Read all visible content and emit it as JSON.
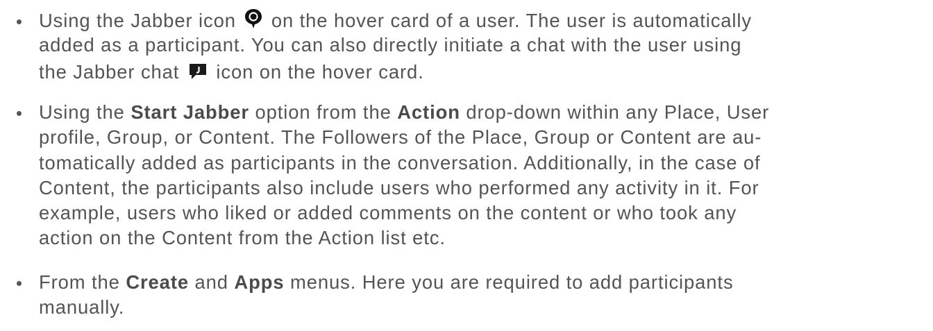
{
  "bullets": [
    {
      "l1_pre": "Using the Jabber icon",
      "l1_post": "on the hover card of a user. The user is automatically",
      "l2": "added as a participant. You can also directly initiate a chat with the user using",
      "l3_pre": "the Jabber chat",
      "l3_post": "icon on the hover card.",
      "icons": [
        "jabber-call-icon",
        "jabber-chat-icon"
      ]
    },
    {
      "l1_a": "Using the",
      "l1_b1": "Start Jabber",
      "l1_c": "option from the",
      "l1_b2": "Action",
      "l1_d": "drop-down within any Place, User",
      "l2": "profile, Group, or Content. The Followers of the Place, Group or Content are au-",
      "l3": "tomatically added as participants in the conversation. Additionally, in the case of",
      "l4": "Content, the participants also include users who performed any activity in it. For",
      "l5": "example, users who liked or added comments on the content or who took any",
      "l6": "action on the Content from the Action list etc."
    },
    {
      "l1_a": "From the",
      "l1_b1": "Create",
      "l1_c": "and",
      "l1_b2": "Apps",
      "l1_d": "menus. Here you are required to add participants",
      "l2": "manually."
    }
  ]
}
